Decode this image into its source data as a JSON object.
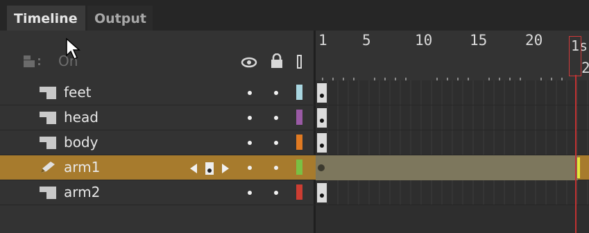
{
  "tabs": [
    {
      "label": "Timeline",
      "active": true
    },
    {
      "label": "Output",
      "active": false
    }
  ],
  "header": {
    "onion_label": "On",
    "ruler_labels": [
      "1",
      "5",
      "10",
      "15",
      "20",
      "2"
    ],
    "time_label": "1s"
  },
  "layers": [
    {
      "name": "feet",
      "color": "#a9d6e0"
    },
    {
      "name": "head",
      "color": "#9a5aa5"
    },
    {
      "name": "body",
      "color": "#e07a22"
    },
    {
      "name": "arm1",
      "color": "#7ac043",
      "selected": true
    },
    {
      "name": "arm2",
      "color": "#cc3d32"
    }
  ],
  "colors": {
    "selected_row": "#a77b2d",
    "playhead": "#c23232"
  }
}
